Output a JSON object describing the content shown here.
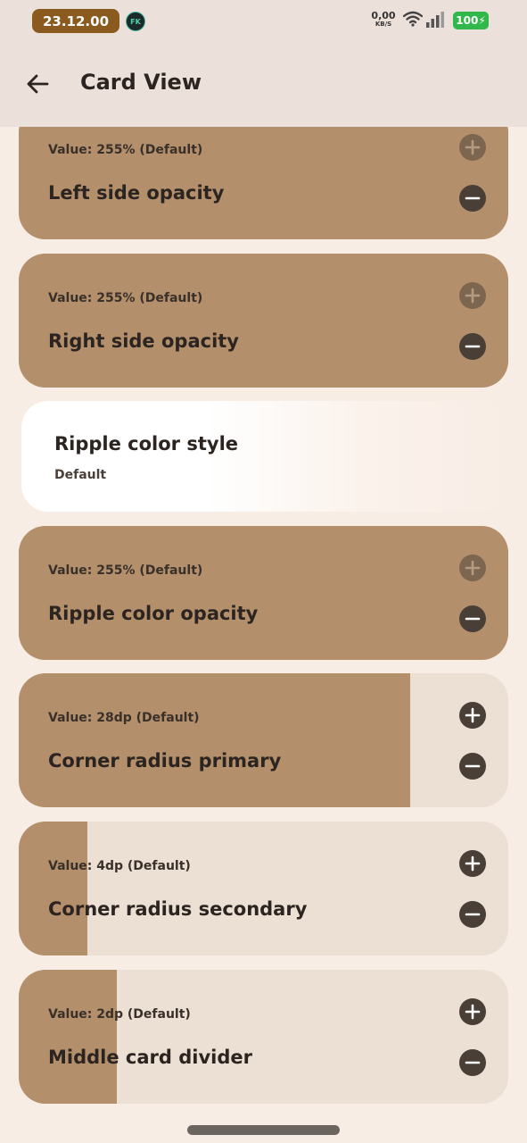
{
  "status": {
    "time": "23.12.00",
    "app_icon_text": "FK",
    "net_speed": "0,00",
    "net_unit": "KB/S",
    "battery": "100"
  },
  "header": {
    "title": "Card View"
  },
  "cards": [
    {
      "value": "Value: 255% (Default)",
      "label": "Left side opacity",
      "fill_fraction": 1.0,
      "plus_enabled": false
    },
    {
      "value": "Value: 255% (Default)",
      "label": "Right side opacity",
      "fill_fraction": 1.0,
      "plus_enabled": false
    },
    {
      "value": "Value: 255% (Default)",
      "label": "Ripple color opacity",
      "fill_fraction": 1.0,
      "plus_enabled": false
    },
    {
      "value": "Value: 28dp (Default)",
      "label": "Corner radius primary",
      "fill_fraction": 0.8,
      "plus_enabled": true
    },
    {
      "value": "Value: 4dp (Default)",
      "label": "Corner radius secondary",
      "fill_fraction": 0.14,
      "plus_enabled": true
    },
    {
      "value": "Value: 2dp (Default)",
      "label": "Middle card divider",
      "fill_fraction": 0.2,
      "plus_enabled": true
    }
  ],
  "ripple": {
    "title": "Ripple color style",
    "value": "Default"
  },
  "colors": {
    "accent_fill": "#b38f6b",
    "track": "#ecdfd3",
    "button": "#4a3f37",
    "background": "#f8ede5"
  }
}
